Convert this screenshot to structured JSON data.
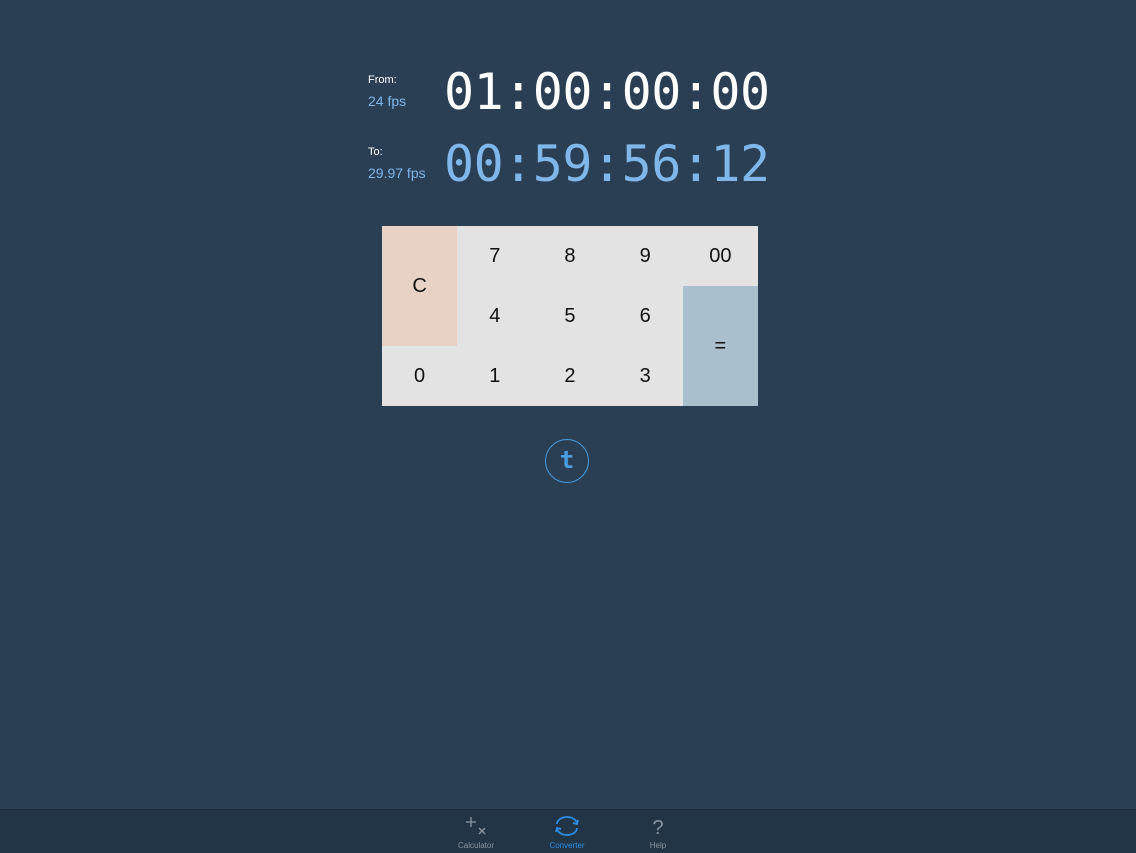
{
  "from": {
    "label": "From:",
    "fps": "24 fps",
    "timecode": "01:00:00:00"
  },
  "to": {
    "label": "To:",
    "fps": "29.97 fps",
    "timecode": "00:59:56:12"
  },
  "keypad": {
    "clear": "C",
    "equals": "=",
    "digits": {
      "k7": "7",
      "k8": "8",
      "k9": "9",
      "k00": "00",
      "k4": "4",
      "k5": "5",
      "k6": "6",
      "k0": "0",
      "k1": "1",
      "k2": "2",
      "k3": "3"
    }
  },
  "toggle_button": {
    "label": "t"
  },
  "tabbar": {
    "active": "Converter",
    "tabs": [
      {
        "label": "Calculator",
        "icon": "plus-times-icon"
      },
      {
        "label": "Converter",
        "icon": "convert-arrows-icon"
      },
      {
        "label": "Help",
        "icon": "question-mark-icon"
      }
    ]
  },
  "colors": {
    "background": "#2a3f54",
    "accent": "#7fb7ea",
    "active_tab": "#2e8de6",
    "clear_key": "#e8d2c5",
    "equals_key": "#a9bfcd",
    "keypad": "#e3e3e3"
  }
}
